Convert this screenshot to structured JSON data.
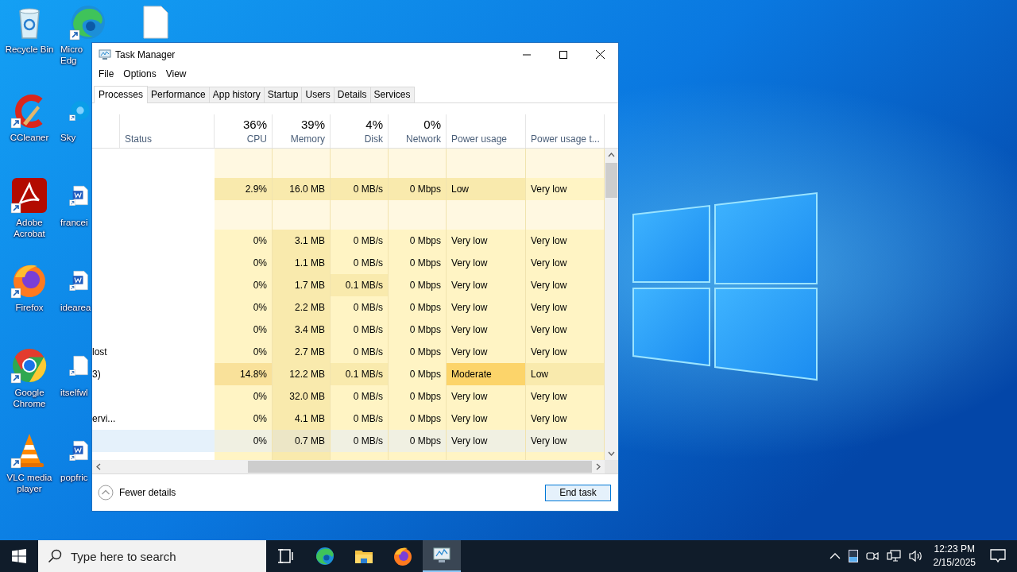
{
  "desktop": {
    "columns": [
      [
        {
          "kind": "recycle-bin",
          "label": "Recycle Bin"
        },
        {
          "kind": "ccleaner",
          "label": "CCleaner"
        },
        {
          "kind": "acrobat",
          "label": "Adobe Acrobat"
        },
        {
          "kind": "firefox",
          "label": "Firefox"
        },
        {
          "kind": "chrome",
          "label": "Google Chrome"
        },
        {
          "kind": "vlc",
          "label": "VLC media player"
        }
      ],
      [
        {
          "kind": "edge",
          "label": "Micro Edg"
        },
        {
          "kind": "skype",
          "label": "Sky"
        },
        {
          "kind": "word",
          "label": "francei"
        },
        {
          "kind": "word",
          "label": "idearea"
        },
        {
          "kind": "file",
          "label": "itselfwl"
        },
        {
          "kind": "word",
          "label": "popfric"
        }
      ],
      [
        {
          "kind": "file"
        }
      ]
    ]
  },
  "window": {
    "title": "Task Manager",
    "menu": [
      "File",
      "Options",
      "View"
    ],
    "tabs": [
      {
        "label": "Processes",
        "selected": true
      },
      {
        "label": "Performance",
        "selected": false
      },
      {
        "label": "App history",
        "selected": false
      },
      {
        "label": "Startup",
        "selected": false
      },
      {
        "label": "Users",
        "selected": false
      },
      {
        "label": "Details",
        "selected": false
      },
      {
        "label": "Services",
        "selected": false
      }
    ],
    "columns": [
      {},
      {
        "label": "Status"
      },
      {
        "total": "36%",
        "label": "CPU"
      },
      {
        "total": "39%",
        "label": "Memory"
      },
      {
        "total": "4%",
        "label": "Disk"
      },
      {
        "total": "0%",
        "label": "Network"
      },
      {
        "label": "Power usage"
      },
      {
        "label": "Power usage t..."
      }
    ],
    "rows": [
      {
        "kind": "blank",
        "selected": false,
        "cells": [
          {
            "text": ""
          },
          {
            "text": ""
          },
          {
            "color": "#fff8e1"
          },
          {
            "color": "#fff8e1"
          },
          {
            "color": "#fff8e1"
          },
          {
            "color": "#fff8e1"
          },
          {
            "color": "#fff8e1"
          },
          {
            "color": "#fff8e1"
          }
        ]
      },
      {
        "kind": "data",
        "selected": false,
        "cells": [
          {
            "text": ""
          },
          {
            "text": ""
          },
          {
            "text": "2.9%",
            "color": "#f9eaad"
          },
          {
            "text": "16.0 MB",
            "color": "#f9eaad"
          },
          {
            "text": "0 MB/s",
            "color": "#f9eaad"
          },
          {
            "text": "0 Mbps",
            "color": "#f9eaad"
          },
          {
            "text": "Low",
            "color": "#f9eaad"
          },
          {
            "text": "Very low",
            "color": "#fff4c4"
          }
        ]
      },
      {
        "kind": "blank",
        "selected": false,
        "cells": [
          {
            "text": ""
          },
          {
            "text": ""
          },
          {
            "color": "#fff8e1"
          },
          {
            "color": "#fff8e1"
          },
          {
            "color": "#fff8e1"
          },
          {
            "color": "#fff8e1"
          },
          {
            "color": "#fff8e1"
          },
          {
            "color": "#fff8e1"
          }
        ]
      },
      {
        "kind": "data",
        "selected": false,
        "cells": [
          {
            "text": ""
          },
          {
            "text": ""
          },
          {
            "text": "0%",
            "color": "#fff4c4"
          },
          {
            "text": "3.1 MB",
            "color": "#f9eaad"
          },
          {
            "text": "0 MB/s",
            "color": "#fff4c4"
          },
          {
            "text": "0 Mbps",
            "color": "#fff4c4"
          },
          {
            "text": "Very low",
            "color": "#fff4c4"
          },
          {
            "text": "Very low",
            "color": "#fff4c4"
          }
        ]
      },
      {
        "kind": "data",
        "selected": false,
        "cells": [
          {
            "text": ""
          },
          {
            "text": ""
          },
          {
            "text": "0%",
            "color": "#fff4c4"
          },
          {
            "text": "1.1 MB",
            "color": "#f9eaad"
          },
          {
            "text": "0 MB/s",
            "color": "#fff4c4"
          },
          {
            "text": "0 Mbps",
            "color": "#fff4c4"
          },
          {
            "text": "Very low",
            "color": "#fff4c4"
          },
          {
            "text": "Very low",
            "color": "#fff4c4"
          }
        ]
      },
      {
        "kind": "data",
        "selected": false,
        "cells": [
          {
            "text": ""
          },
          {
            "text": ""
          },
          {
            "text": "0%",
            "color": "#fff4c4"
          },
          {
            "text": "1.7 MB",
            "color": "#f9eaad"
          },
          {
            "text": "0.1 MB/s",
            "color": "#f9eaad"
          },
          {
            "text": "0 Mbps",
            "color": "#fff4c4"
          },
          {
            "text": "Very low",
            "color": "#fff4c4"
          },
          {
            "text": "Very low",
            "color": "#fff4c4"
          }
        ]
      },
      {
        "kind": "data",
        "selected": false,
        "cells": [
          {
            "text": ""
          },
          {
            "text": ""
          },
          {
            "text": "0%",
            "color": "#fff4c4"
          },
          {
            "text": "2.2 MB",
            "color": "#f9eaad"
          },
          {
            "text": "0 MB/s",
            "color": "#fff4c4"
          },
          {
            "text": "0 Mbps",
            "color": "#fff4c4"
          },
          {
            "text": "Very low",
            "color": "#fff4c4"
          },
          {
            "text": "Very low",
            "color": "#fff4c4"
          }
        ]
      },
      {
        "kind": "data",
        "selected": false,
        "cells": [
          {
            "text": ""
          },
          {
            "text": ""
          },
          {
            "text": "0%",
            "color": "#fff4c4"
          },
          {
            "text": "3.4 MB",
            "color": "#f9eaad"
          },
          {
            "text": "0 MB/s",
            "color": "#fff4c4"
          },
          {
            "text": "0 Mbps",
            "color": "#fff4c4"
          },
          {
            "text": "Very low",
            "color": "#fff4c4"
          },
          {
            "text": "Very low",
            "color": "#fff4c4"
          }
        ]
      },
      {
        "kind": "data",
        "selected": false,
        "cells": [
          {
            "text": "lost"
          },
          {
            "text": ""
          },
          {
            "text": "0%",
            "color": "#fff4c4"
          },
          {
            "text": "2.7 MB",
            "color": "#f9eaad"
          },
          {
            "text": "0 MB/s",
            "color": "#fff4c4"
          },
          {
            "text": "0 Mbps",
            "color": "#fff4c4"
          },
          {
            "text": "Very low",
            "color": "#fff4c4"
          },
          {
            "text": "Very low",
            "color": "#fff4c4"
          }
        ]
      },
      {
        "kind": "data",
        "selected": false,
        "cells": [
          {
            "text": "3)"
          },
          {
            "text": ""
          },
          {
            "text": "14.8%",
            "color": "#f9e19a"
          },
          {
            "text": "12.2 MB",
            "color": "#f9eaad"
          },
          {
            "text": "0.1 MB/s",
            "color": "#f9eaad"
          },
          {
            "text": "0 Mbps",
            "color": "#fff4c4"
          },
          {
            "text": "Moderate",
            "color": "#fcd46a"
          },
          {
            "text": "Low",
            "color": "#f9eaad"
          }
        ]
      },
      {
        "kind": "data",
        "selected": false,
        "cells": [
          {
            "text": ""
          },
          {
            "text": ""
          },
          {
            "text": "0%",
            "color": "#fff4c4"
          },
          {
            "text": "32.0 MB",
            "color": "#f9eaad"
          },
          {
            "text": "0 MB/s",
            "color": "#fff4c4"
          },
          {
            "text": "0 Mbps",
            "color": "#fff4c4"
          },
          {
            "text": "Very low",
            "color": "#fff4c4"
          },
          {
            "text": "Very low",
            "color": "#fff4c4"
          }
        ]
      },
      {
        "kind": "data",
        "selected": false,
        "cells": [
          {
            "text": "ervi..."
          },
          {
            "text": ""
          },
          {
            "text": "0%",
            "color": "#fff4c4"
          },
          {
            "text": "4.1 MB",
            "color": "#f9eaad"
          },
          {
            "text": "0 MB/s",
            "color": "#fff4c4"
          },
          {
            "text": "0 Mbps",
            "color": "#fff4c4"
          },
          {
            "text": "Very low",
            "color": "#fff4c4"
          },
          {
            "text": "Very low",
            "color": "#fff4c4"
          }
        ]
      },
      {
        "kind": "data",
        "selected": true,
        "cells": [
          {
            "text": ""
          },
          {
            "text": ""
          },
          {
            "text": "0%",
            "color": "#f0f0e2"
          },
          {
            "text": "0.7 MB",
            "color": "#ece6c6"
          },
          {
            "text": "0 MB/s",
            "color": "#f0f0e2"
          },
          {
            "text": "0 Mbps",
            "color": "#f0f0e2"
          },
          {
            "text": "Very low",
            "color": "#f0f0e2"
          },
          {
            "text": "Very low",
            "color": "#f0f0e2"
          }
        ]
      },
      {
        "kind": "blank",
        "selected": false,
        "cells": [
          {
            "text": ""
          },
          {
            "text": ""
          },
          {
            "color": "#fff4c4"
          },
          {
            "color": "#f9eaad"
          },
          {
            "color": "#fff4c4"
          },
          {
            "color": "#fff4c4"
          },
          {
            "color": "#fff4c4"
          },
          {
            "color": "#fff4c4"
          }
        ]
      }
    ],
    "fewer_details": "Fewer details",
    "end_task": "End task"
  },
  "taskbar": {
    "search": {
      "placeholder": "Type here to search"
    },
    "apps": [
      {
        "kind": "task-view",
        "selected": false
      },
      {
        "kind": "edge",
        "selected": false
      },
      {
        "kind": "explorer",
        "selected": false
      },
      {
        "kind": "firefox",
        "selected": false
      },
      {
        "kind": "task-manager",
        "selected": true
      }
    ],
    "clock": {
      "time": "12:23 PM",
      "date": "2/15/2025"
    }
  }
}
